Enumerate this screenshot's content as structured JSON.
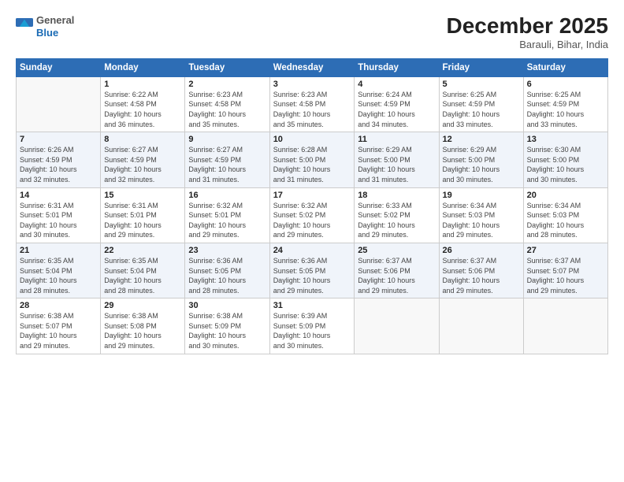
{
  "logo": {
    "general": "General",
    "blue": "Blue"
  },
  "title": "December 2025",
  "subtitle": "Barauli, Bihar, India",
  "days_header": [
    "Sunday",
    "Monday",
    "Tuesday",
    "Wednesday",
    "Thursday",
    "Friday",
    "Saturday"
  ],
  "weeks": [
    [
      {
        "day": "",
        "info": ""
      },
      {
        "day": "1",
        "info": "Sunrise: 6:22 AM\nSunset: 4:58 PM\nDaylight: 10 hours\nand 36 minutes."
      },
      {
        "day": "2",
        "info": "Sunrise: 6:23 AM\nSunset: 4:58 PM\nDaylight: 10 hours\nand 35 minutes."
      },
      {
        "day": "3",
        "info": "Sunrise: 6:23 AM\nSunset: 4:58 PM\nDaylight: 10 hours\nand 35 minutes."
      },
      {
        "day": "4",
        "info": "Sunrise: 6:24 AM\nSunset: 4:59 PM\nDaylight: 10 hours\nand 34 minutes."
      },
      {
        "day": "5",
        "info": "Sunrise: 6:25 AM\nSunset: 4:59 PM\nDaylight: 10 hours\nand 33 minutes."
      },
      {
        "day": "6",
        "info": "Sunrise: 6:25 AM\nSunset: 4:59 PM\nDaylight: 10 hours\nand 33 minutes."
      }
    ],
    [
      {
        "day": "7",
        "info": "Sunrise: 6:26 AM\nSunset: 4:59 PM\nDaylight: 10 hours\nand 32 minutes."
      },
      {
        "day": "8",
        "info": "Sunrise: 6:27 AM\nSunset: 4:59 PM\nDaylight: 10 hours\nand 32 minutes."
      },
      {
        "day": "9",
        "info": "Sunrise: 6:27 AM\nSunset: 4:59 PM\nDaylight: 10 hours\nand 31 minutes."
      },
      {
        "day": "10",
        "info": "Sunrise: 6:28 AM\nSunset: 5:00 PM\nDaylight: 10 hours\nand 31 minutes."
      },
      {
        "day": "11",
        "info": "Sunrise: 6:29 AM\nSunset: 5:00 PM\nDaylight: 10 hours\nand 31 minutes."
      },
      {
        "day": "12",
        "info": "Sunrise: 6:29 AM\nSunset: 5:00 PM\nDaylight: 10 hours\nand 30 minutes."
      },
      {
        "day": "13",
        "info": "Sunrise: 6:30 AM\nSunset: 5:00 PM\nDaylight: 10 hours\nand 30 minutes."
      }
    ],
    [
      {
        "day": "14",
        "info": "Sunrise: 6:31 AM\nSunset: 5:01 PM\nDaylight: 10 hours\nand 30 minutes."
      },
      {
        "day": "15",
        "info": "Sunrise: 6:31 AM\nSunset: 5:01 PM\nDaylight: 10 hours\nand 29 minutes."
      },
      {
        "day": "16",
        "info": "Sunrise: 6:32 AM\nSunset: 5:01 PM\nDaylight: 10 hours\nand 29 minutes."
      },
      {
        "day": "17",
        "info": "Sunrise: 6:32 AM\nSunset: 5:02 PM\nDaylight: 10 hours\nand 29 minutes."
      },
      {
        "day": "18",
        "info": "Sunrise: 6:33 AM\nSunset: 5:02 PM\nDaylight: 10 hours\nand 29 minutes."
      },
      {
        "day": "19",
        "info": "Sunrise: 6:34 AM\nSunset: 5:03 PM\nDaylight: 10 hours\nand 29 minutes."
      },
      {
        "day": "20",
        "info": "Sunrise: 6:34 AM\nSunset: 5:03 PM\nDaylight: 10 hours\nand 28 minutes."
      }
    ],
    [
      {
        "day": "21",
        "info": "Sunrise: 6:35 AM\nSunset: 5:04 PM\nDaylight: 10 hours\nand 28 minutes."
      },
      {
        "day": "22",
        "info": "Sunrise: 6:35 AM\nSunset: 5:04 PM\nDaylight: 10 hours\nand 28 minutes."
      },
      {
        "day": "23",
        "info": "Sunrise: 6:36 AM\nSunset: 5:05 PM\nDaylight: 10 hours\nand 28 minutes."
      },
      {
        "day": "24",
        "info": "Sunrise: 6:36 AM\nSunset: 5:05 PM\nDaylight: 10 hours\nand 29 minutes."
      },
      {
        "day": "25",
        "info": "Sunrise: 6:37 AM\nSunset: 5:06 PM\nDaylight: 10 hours\nand 29 minutes."
      },
      {
        "day": "26",
        "info": "Sunrise: 6:37 AM\nSunset: 5:06 PM\nDaylight: 10 hours\nand 29 minutes."
      },
      {
        "day": "27",
        "info": "Sunrise: 6:37 AM\nSunset: 5:07 PM\nDaylight: 10 hours\nand 29 minutes."
      }
    ],
    [
      {
        "day": "28",
        "info": "Sunrise: 6:38 AM\nSunset: 5:07 PM\nDaylight: 10 hours\nand 29 minutes."
      },
      {
        "day": "29",
        "info": "Sunrise: 6:38 AM\nSunset: 5:08 PM\nDaylight: 10 hours\nand 29 minutes."
      },
      {
        "day": "30",
        "info": "Sunrise: 6:38 AM\nSunset: 5:09 PM\nDaylight: 10 hours\nand 30 minutes."
      },
      {
        "day": "31",
        "info": "Sunrise: 6:39 AM\nSunset: 5:09 PM\nDaylight: 10 hours\nand 30 minutes."
      },
      {
        "day": "",
        "info": ""
      },
      {
        "day": "",
        "info": ""
      },
      {
        "day": "",
        "info": ""
      }
    ]
  ]
}
